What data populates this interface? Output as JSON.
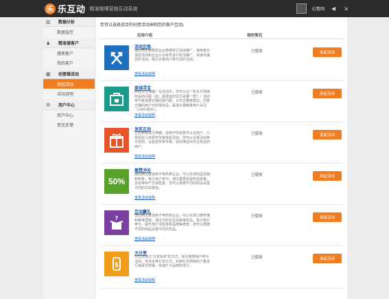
{
  "header": {
    "logo_mark": "乐",
    "logo_text": "乐互动",
    "subtitle": "精准微博营销互动系统",
    "user_name": "幻看网"
  },
  "sidebar": {
    "sections": [
      {
        "title": "数据分析",
        "icon": "bar-chart-icon",
        "items": [
          "数据监控"
        ]
      },
      {
        "title": "精准搜客户",
        "icon": "user-icon",
        "items": [
          "搜索客户",
          "我的客户"
        ]
      },
      {
        "title": "创意微活动",
        "icon": "grid-icon",
        "items": [
          "发起活动",
          "活动说明"
        ]
      },
      {
        "title": "用户中心",
        "icon": "gear-icon",
        "items": [
          "用户中心",
          "意见反馈"
        ]
      }
    ],
    "active_item": "发起活动"
  },
  "main": {
    "intro": "您可以选择适合的创意活动来和您的客户互动。",
    "columns": [
      "应用介绍",
      "授权情况"
    ],
    "rows": [
      {
        "title": "活动互推",
        "desc": "适应网主要帮助企业微博进行活动推广，使用者在发起活动和企业公众帐号进行新活推广，快速传播您的活动。吸引大量用户参与您的活动。",
        "link": "查看活动说明",
        "status": "已使用",
        "button": "发起活动",
        "color": "#1e6fbf",
        "icon": "swap-arrows-icon"
      },
      {
        "title": "商城寻宝",
        "desc": "网络寻宝神器！在活动中，您可以在一些关于网络商品的问题（如：最便宜的宝贝是哪一款？）活动参与者需要正确回答问题，公开正确答案后，回答正确的用户可获得奖品，赢得大量精准用户关注（100%真实）。",
        "link": "查看活动说明",
        "status": "已使用",
        "button": "发起活动",
        "color": "#1a9a8a",
        "icon": "shop-icon"
      },
      {
        "title": "发奖互动",
        "desc": "企业微博指引神器，适用于所有数字认证用户，只需轻松几步即可快速发起活动，您可以设置活动参与规则，设置发奖条件等，自动筛选出符合奖品的用户。",
        "link": "查看活动说明",
        "status": "已使用",
        "button": "发起活动",
        "color": "#e8542a",
        "icon": "gift-icon"
      },
      {
        "title": "集赞冲关",
        "desc": "适应网主要适用于电商类企业，可以实现商品促销和积累，吸引用户参与，通过集赞获得竞拍资格，自动排序产生获胜者，您可以根据不同的商品设置不同的冲关数值。",
        "link": "查看活动说明",
        "status": "已使用",
        "button": "发起活动",
        "color": "#5aa02c",
        "icon": "percent-icon"
      },
      {
        "title": "互动赢礼",
        "desc": "适应网主要适用于电商类企业，可以实现口碑传播和精准营销，通过与粉丝互动获得奖品，吸引用户参与，提升用户活跃度和品牌美誉度，您可以根据不同的商品设置不同的奖品。",
        "link": "查看活动说明",
        "status": "已使用",
        "button": "发起活动",
        "color": "#7b3fa0",
        "icon": "open-box-icon"
      },
      {
        "title": "大分享",
        "desc": "本应用通过\"分享有奖\"的方式，吸引微博用户参与活动，支持多种分享方式，利用社交网络的力量进行病毒式传播，快速扩大品牌影响力。",
        "link": "查看活动说明",
        "status": "已使用",
        "button": "发起活动",
        "color": "#f29d1a",
        "icon": "share-icon"
      }
    ]
  }
}
